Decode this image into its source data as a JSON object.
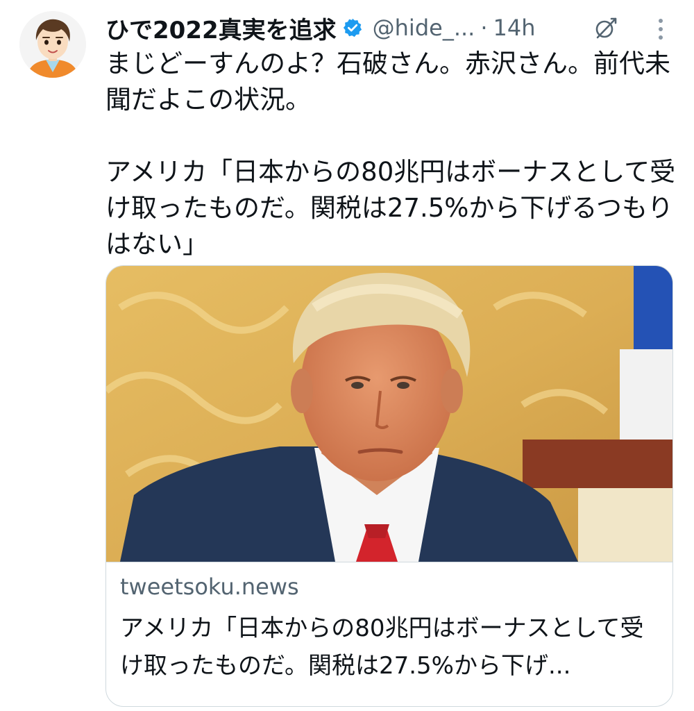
{
  "author": {
    "display_name": "ひで2022真実を追求",
    "handle": "@hide_...",
    "separator": "·",
    "time": "14h",
    "avatar_icon": "cartoon-man-avatar",
    "verified_icon": "verified-badge-icon",
    "verified_color": "#1d9bf0"
  },
  "actions": {
    "grok_icon": "grok-icon",
    "more_icon": "more-vertical-icon"
  },
  "tweet": {
    "line1": "まじどーすんのよ？石破さん。赤沢さん。前代未聞だよこの状況。",
    "line2": "アメリカ「日本からの80兆円はボーナスとして受け取ったものだ。関税は27.5%から下げるつもりはない」"
  },
  "card": {
    "image_subject": "man-in-navy-suit-red-tie-photo",
    "domain": "tweetsoku.news",
    "title": "アメリカ「日本からの80兆円はボーナスとして受け取ったものだ。関税は27.5%から下げ..."
  },
  "colors": {
    "text": "#0f1419",
    "secondary": "#536471",
    "border": "#cfd9de",
    "accent": "#1d9bf0"
  }
}
